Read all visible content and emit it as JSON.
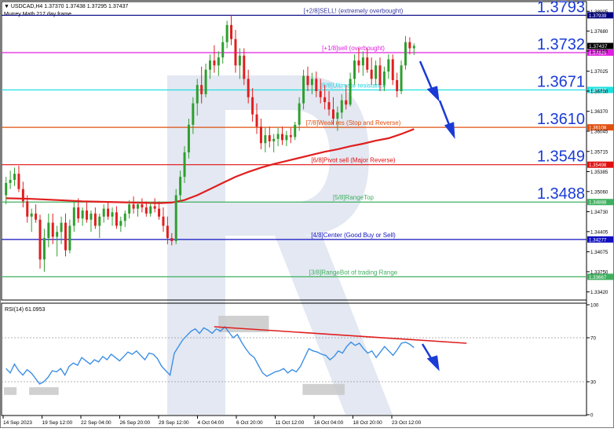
{
  "header": {
    "symbol_line": "USDCAD,H4  1.37370 1.37438 1.37295 1.37437",
    "indicator": "Murrey Math 217 day frame"
  },
  "rsi_label": "RSI(14) 61.0953",
  "colors": {
    "up_candle": "#2e9e2e",
    "down_candle": "#e01e1e",
    "ma": "#e01e1e",
    "rsi": "#3d8fe6",
    "arrow": "#1a3bd6",
    "watermark": "#dde4f0",
    "zone": "#c8c8c8"
  },
  "chart_data": [
    {
      "type": "line",
      "title": "USDCAD,H4",
      "ylim": [
        1.333,
        1.3815
      ],
      "price_ticks": [
        "1.38005",
        "1.37680",
        "1.37355",
        "1.37025",
        "1.36700",
        "1.36370",
        "1.36045",
        "1.35715",
        "1.35385",
        "1.35060",
        "1.34730",
        "1.34405",
        "1.34075",
        "1.33750",
        "1.33420"
      ],
      "x_ticks": [
        "14 Sep 2023",
        "19 Sep 12:00",
        "22 Sep 04:00",
        "26 Sep 20:00",
        "29 Sep 12:00",
        "4 Oct 04:00",
        "6 Oct 20:00",
        "11 Oct 12:00",
        "16 Oct 04:00",
        "18 Oct 20:00",
        "23 Oct 12:00"
      ],
      "current_price": "1.37437",
      "levels": [
        {
          "price": 1.37939,
          "tag": "1.37939",
          "big": "1.3793",
          "label": "[+2/8]SELL! (extremely overbought)",
          "color": "#000080",
          "label_color": "#3a3aa0"
        },
        {
          "price": 1.37329,
          "tag": "1.37329",
          "big": "1.3732",
          "label": "[+1/8]sell (overbought)",
          "color": "#e020e0",
          "label_color": "#e020e0"
        },
        {
          "price": 1.36719,
          "tag": "1.36719",
          "big": "1.3671",
          "label": "[8/8]Ultimate resistance",
          "color": "#20e0e0",
          "label_color": "#20d0e0"
        },
        {
          "price": 1.36108,
          "tag": "1.36108",
          "big": "1.3610",
          "label": "[7/8]Weak res (Stop and Reverse)",
          "color": "#e05010",
          "label_color": "#e05010"
        },
        {
          "price": 1.35498,
          "tag": "1.35498",
          "big": "1.3549",
          "label": "[6/8]Pivot sell (Major Reverse)",
          "color": "#e01010",
          "label_color": "#e01010"
        },
        {
          "price": 1.34888,
          "tag": "1.34888",
          "big": "1.3488",
          "label": "[5/8]RangeTop",
          "color": "#40b060",
          "label_color": "#40b060"
        },
        {
          "price": 1.34277,
          "tag": "1.34277",
          "big": "",
          "label": "[4/8]Center (Good Buy or Sell)",
          "color": "#1010c0",
          "label_color": "#1010c0"
        },
        {
          "price": 1.33667,
          "tag": "1.33667",
          "big": "",
          "label": "[3/8]RangeBot of trading Range",
          "color": "#40b060",
          "label_color": "#40b060"
        }
      ],
      "candles": [
        [
          1.35,
          1.353,
          1.3485,
          1.352
        ],
        [
          1.352,
          1.354,
          1.351,
          1.3525
        ],
        [
          1.3525,
          1.3545,
          1.3515,
          1.3535
        ],
        [
          1.3535,
          1.3548,
          1.3505,
          1.351
        ],
        [
          1.351,
          1.3522,
          1.348,
          1.349
        ],
        [
          1.349,
          1.35,
          1.3455,
          1.3465
        ],
        [
          1.3465,
          1.3478,
          1.344,
          1.347
        ],
        [
          1.347,
          1.3485,
          1.3455,
          1.346
        ],
        [
          1.346,
          1.3468,
          1.338,
          1.3395
        ],
        [
          1.3395,
          1.3445,
          1.3375,
          1.343
        ],
        [
          1.343,
          1.347,
          1.3415,
          1.3455
        ],
        [
          1.3455,
          1.347,
          1.342,
          1.3432
        ],
        [
          1.3432,
          1.345,
          1.34,
          1.344
        ],
        [
          1.344,
          1.3465,
          1.342,
          1.3455
        ],
        [
          1.3455,
          1.347,
          1.34,
          1.341
        ],
        [
          1.341,
          1.346,
          1.3405,
          1.345
        ],
        [
          1.345,
          1.349,
          1.344,
          1.348
        ],
        [
          1.348,
          1.3495,
          1.3455,
          1.3462
        ],
        [
          1.3462,
          1.348,
          1.345,
          1.3475
        ],
        [
          1.3475,
          1.349,
          1.3455,
          1.346
        ],
        [
          1.346,
          1.3475,
          1.344,
          1.347
        ],
        [
          1.347,
          1.348,
          1.3445,
          1.345
        ],
        [
          1.345,
          1.347,
          1.343,
          1.3465
        ],
        [
          1.3465,
          1.3485,
          1.3455,
          1.3478
        ],
        [
          1.3478,
          1.349,
          1.346,
          1.3465
        ],
        [
          1.3465,
          1.348,
          1.345,
          1.3472
        ],
        [
          1.3472,
          1.3482,
          1.3445,
          1.345
        ],
        [
          1.345,
          1.3465,
          1.344,
          1.3458
        ],
        [
          1.3458,
          1.3475,
          1.3448,
          1.347
        ],
        [
          1.347,
          1.3492,
          1.3462,
          1.3485
        ],
        [
          1.3485,
          1.3498,
          1.347,
          1.3478
        ],
        [
          1.3478,
          1.349,
          1.3465,
          1.3485
        ],
        [
          1.3485,
          1.3495,
          1.3472,
          1.348
        ],
        [
          1.348,
          1.349,
          1.3465,
          1.347
        ],
        [
          1.347,
          1.3488,
          1.3465,
          1.3482
        ],
        [
          1.3482,
          1.3495,
          1.3472,
          1.3478
        ],
        [
          1.3478,
          1.349,
          1.346,
          1.3465
        ],
        [
          1.3465,
          1.348,
          1.344,
          1.345
        ],
        [
          1.345,
          1.3465,
          1.342,
          1.343
        ],
        [
          1.343,
          1.3438,
          1.3418,
          1.3425
        ],
        [
          1.3425,
          1.351,
          1.342,
          1.35
        ],
        [
          1.35,
          1.354,
          1.349,
          1.353
        ],
        [
          1.353,
          1.358,
          1.352,
          1.357
        ],
        [
          1.357,
          1.3625,
          1.356,
          1.3615
        ],
        [
          1.3615,
          1.366,
          1.36,
          1.365
        ],
        [
          1.365,
          1.369,
          1.363,
          1.368
        ],
        [
          1.368,
          1.371,
          1.365,
          1.3665
        ],
        [
          1.3665,
          1.3715,
          1.366,
          1.3705
        ],
        [
          1.3705,
          1.373,
          1.369,
          1.372
        ],
        [
          1.372,
          1.3745,
          1.37,
          1.3712
        ],
        [
          1.3712,
          1.3735,
          1.3695,
          1.3725
        ],
        [
          1.3725,
          1.376,
          1.3715,
          1.375
        ],
        [
          1.375,
          1.3785,
          1.374,
          1.3778
        ],
        [
          1.3778,
          1.3795,
          1.3745,
          1.3755
        ],
        [
          1.3755,
          1.377,
          1.37,
          1.3712
        ],
        [
          1.3712,
          1.374,
          1.369,
          1.3728
        ],
        [
          1.3728,
          1.374,
          1.368,
          1.369
        ],
        [
          1.369,
          1.3705,
          1.365,
          1.366
        ],
        [
          1.366,
          1.3675,
          1.362,
          1.3632
        ],
        [
          1.3632,
          1.365,
          1.36,
          1.3612
        ],
        [
          1.3612,
          1.3625,
          1.3575,
          1.3585
        ],
        [
          1.3585,
          1.361,
          1.357,
          1.3598
        ],
        [
          1.3598,
          1.3612,
          1.3578,
          1.3588
        ],
        [
          1.3588,
          1.36,
          1.357,
          1.3592
        ],
        [
          1.3592,
          1.361,
          1.358,
          1.36
        ],
        [
          1.36,
          1.3612,
          1.3582,
          1.359
        ],
        [
          1.359,
          1.3605,
          1.358,
          1.3598
        ],
        [
          1.3598,
          1.361,
          1.3585,
          1.3595
        ],
        [
          1.3595,
          1.362,
          1.359,
          1.3615
        ],
        [
          1.3615,
          1.366,
          1.3605,
          1.365
        ],
        [
          1.365,
          1.3705,
          1.364,
          1.3695
        ],
        [
          1.3695,
          1.371,
          1.367,
          1.368
        ],
        [
          1.368,
          1.37,
          1.3665,
          1.369
        ],
        [
          1.369,
          1.3702,
          1.366,
          1.367
        ],
        [
          1.367,
          1.369,
          1.365,
          1.366
        ],
        [
          1.366,
          1.368,
          1.364,
          1.3652
        ],
        [
          1.3652,
          1.367,
          1.363,
          1.364
        ],
        [
          1.364,
          1.366,
          1.3615,
          1.3625
        ],
        [
          1.3625,
          1.3645,
          1.3605,
          1.3635
        ],
        [
          1.3635,
          1.3665,
          1.3625,
          1.3655
        ],
        [
          1.3655,
          1.368,
          1.364,
          1.3648
        ],
        [
          1.3648,
          1.37,
          1.3645,
          1.369
        ],
        [
          1.369,
          1.373,
          1.368,
          1.372
        ],
        [
          1.372,
          1.374,
          1.37,
          1.3712
        ],
        [
          1.3712,
          1.3735,
          1.3695,
          1.3725
        ],
        [
          1.3725,
          1.374,
          1.37,
          1.3705
        ],
        [
          1.3705,
          1.3725,
          1.368,
          1.369
        ],
        [
          1.369,
          1.372,
          1.368,
          1.3712
        ],
        [
          1.3712,
          1.3725,
          1.367,
          1.368
        ],
        [
          1.368,
          1.371,
          1.367,
          1.3702
        ],
        [
          1.3702,
          1.373,
          1.369,
          1.3722
        ],
        [
          1.3722,
          1.373,
          1.368,
          1.3688
        ],
        [
          1.3688,
          1.37,
          1.366,
          1.367
        ],
        [
          1.367,
          1.372,
          1.3665,
          1.3712
        ],
        [
          1.3712,
          1.376,
          1.3705,
          1.375
        ],
        [
          1.375,
          1.3758,
          1.373,
          1.374
        ],
        [
          1.374,
          1.3748,
          1.3729,
          1.3744
        ]
      ],
      "ma": [
        [
          0,
          1.3495
        ],
        [
          6,
          1.3494
        ],
        [
          12,
          1.3492
        ],
        [
          18,
          1.349
        ],
        [
          24,
          1.3489
        ],
        [
          30,
          1.3488
        ],
        [
          36,
          1.3487
        ],
        [
          39,
          1.3488
        ],
        [
          42,
          1.3492
        ],
        [
          45,
          1.35
        ],
        [
          48,
          1.351
        ],
        [
          51,
          1.352
        ],
        [
          54,
          1.353
        ],
        [
          57,
          1.3538
        ],
        [
          60,
          1.3545
        ],
        [
          63,
          1.3551
        ],
        [
          66,
          1.3556
        ],
        [
          69,
          1.3561
        ],
        [
          72,
          1.3566
        ],
        [
          75,
          1.3571
        ],
        [
          78,
          1.3575
        ],
        [
          81,
          1.358
        ],
        [
          84,
          1.3584
        ],
        [
          87,
          1.3589
        ],
        [
          90,
          1.3593
        ],
        [
          93,
          1.36
        ],
        [
          96,
          1.3608
        ]
      ]
    },
    {
      "type": "line",
      "title": "RSI(14) 61.0953",
      "ylim": [
        0,
        100
      ],
      "y_ticks": [
        "100",
        "70",
        "30",
        "0"
      ],
      "values": [
        42,
        38,
        46,
        40,
        36,
        41,
        38,
        33,
        28,
        30,
        34,
        40,
        39,
        42,
        36,
        44,
        47,
        45,
        52,
        49,
        46,
        50,
        48,
        53,
        50,
        55,
        52,
        49,
        53,
        57,
        55,
        58,
        54,
        50,
        56,
        55,
        51,
        44,
        40,
        36,
        56,
        62,
        68,
        72,
        76,
        78,
        74,
        79,
        77,
        74,
        78,
        76,
        80,
        75,
        70,
        73,
        66,
        60,
        55,
        52,
        45,
        38,
        35,
        37,
        39,
        40,
        42,
        38,
        41,
        39,
        44,
        52,
        60,
        58,
        57,
        55,
        54,
        50,
        53,
        58,
        56,
        62,
        66,
        63,
        65,
        60,
        56,
        58,
        52,
        57,
        62,
        58,
        54,
        59,
        65,
        66,
        64,
        61
      ],
      "trendline": [
        [
          50,
          80
        ],
        [
          110,
          65
        ]
      ],
      "zones": [
        {
          "from": 0,
          "to": 2,
          "low": 18,
          "high": 25
        },
        {
          "from": 6,
          "to": 12,
          "low": 18,
          "high": 25
        },
        {
          "from": 51,
          "to": 62,
          "low": 75,
          "high": 90
        },
        {
          "from": 71,
          "to": 80,
          "low": 18,
          "high": 28
        }
      ]
    }
  ]
}
